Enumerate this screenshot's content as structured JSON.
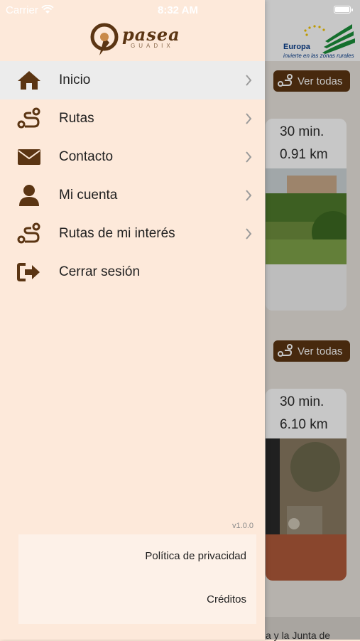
{
  "status_bar": {
    "carrier": "Carrier",
    "time": "8:32 AM"
  },
  "brand": {
    "name": "pasea",
    "subtitle": "GUADIX"
  },
  "eu_banner": {
    "title": "Europa",
    "subtitle": "invierte en las zonas rurales"
  },
  "menu": {
    "items": [
      {
        "label": "Inicio",
        "icon": "home-icon",
        "chevron": true
      },
      {
        "label": "Rutas",
        "icon": "route-icon",
        "chevron": true
      },
      {
        "label": "Contacto",
        "icon": "envelope-icon",
        "chevron": true
      },
      {
        "label": "Mi cuenta",
        "icon": "user-icon",
        "chevron": true
      },
      {
        "label": "Rutas de mi interés",
        "icon": "route-icon",
        "chevron": true
      },
      {
        "label": "Cerrar sesión",
        "icon": "sign-out-icon",
        "chevron": false
      }
    ]
  },
  "version": "v1.0.0",
  "footer": {
    "privacy": "Política de privacidad",
    "credits": "Créditos"
  },
  "background": {
    "see_all_label": "Ver todas",
    "cards": [
      {
        "duration": "30 min.",
        "distance": "0.91 km"
      },
      {
        "duration": "30 min.",
        "distance": "6.10 km"
      }
    ],
    "bottom_text": "a y la Junta de"
  },
  "colors": {
    "brand_brown": "#5b3513",
    "drawer_bg": "#fde9da"
  }
}
